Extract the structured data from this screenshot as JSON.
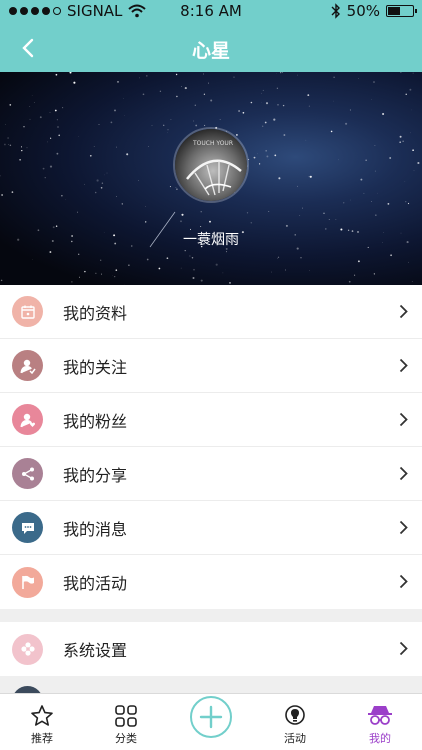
{
  "status_bar": {
    "carrier": "SIGNAL",
    "time": "8:16 AM",
    "battery": "50%",
    "battery_level": 0.5
  },
  "nav": {
    "title": "心星"
  },
  "profile": {
    "username": "一蓑烟雨",
    "avatar_caption": "TOUCH YOUR"
  },
  "menu": [
    {
      "label": "我的资料",
      "icon": "calendar-icon",
      "color": "#f0b3a8"
    },
    {
      "label": "我的关注",
      "icon": "person-check-icon",
      "color": "#b98082"
    },
    {
      "label": "我的粉丝",
      "icon": "person-heart-icon",
      "color": "#e8879a"
    },
    {
      "label": "我的分享",
      "icon": "share-icon",
      "color": "#a98195"
    },
    {
      "label": "我的消息",
      "icon": "chat-bubble-icon",
      "color": "#3b6a8a"
    },
    {
      "label": "我的活动",
      "icon": "flag-icon",
      "color": "#f2a99a"
    }
  ],
  "settings": {
    "label": "系统设置",
    "icon": "flower-icon",
    "color": "#f2c3cc"
  },
  "tabbar": {
    "tabs": [
      {
        "label": "推荐",
        "icon": "star-icon"
      },
      {
        "label": "分类",
        "icon": "grid-icon"
      },
      {
        "label": "活动",
        "icon": "lightbulb-icon"
      },
      {
        "label": "我的",
        "icon": "glasses-icon",
        "active": true
      }
    ],
    "accent": "#72cfcb",
    "active_color": "#9b3fc9"
  }
}
